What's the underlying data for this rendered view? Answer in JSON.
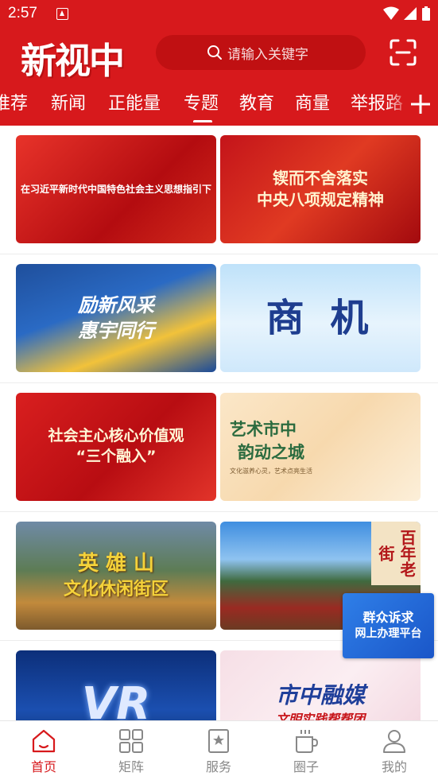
{
  "status": {
    "time": "2:57"
  },
  "header": {
    "logo": "新视中",
    "search_placeholder": "请输入关键字"
  },
  "tabs": [
    {
      "label": "推荐"
    },
    {
      "label": "新闻"
    },
    {
      "label": "正能量"
    },
    {
      "label": "专题",
      "active": true
    },
    {
      "label": "教育"
    },
    {
      "label": "商量"
    },
    {
      "label": "举报路"
    }
  ],
  "cards": [
    {
      "line1": "在习近平新时代中国特色社会主义思想指引下",
      "line2": ""
    },
    {
      "line1": "锲而不舍落实",
      "line2": "中央八项规定精神"
    },
    {
      "line1": "励新风采",
      "line2": "惠宇同行"
    },
    {
      "line1": "商 机",
      "line2": ""
    },
    {
      "line1": "社会主心核心价值观",
      "line2": "“三个融入”"
    },
    {
      "line1": "艺术市中",
      "line2": "韵动之城",
      "sub": "文化滋养心灵，艺术点亮生活"
    },
    {
      "line1": "英 雄 山",
      "line2": "文化休闲街区"
    },
    {
      "line1": "百年老街",
      "line2": ""
    },
    {
      "line1": "VR",
      "line2": ""
    },
    {
      "line1": "市中融媒",
      "line2": "文明实践帮帮团"
    }
  ],
  "float_banner": {
    "line1": "群众诉求",
    "line2": "网上办理平台"
  },
  "bottom_nav": [
    {
      "label": "首页",
      "icon": "home-icon",
      "active": true
    },
    {
      "label": "矩阵",
      "icon": "grid-icon"
    },
    {
      "label": "服务",
      "icon": "star-bookmark-icon"
    },
    {
      "label": "圈子",
      "icon": "cup-icon"
    },
    {
      "label": "我的",
      "icon": "user-icon"
    }
  ],
  "colors": {
    "brand_red": "#d7191c",
    "nav_active": "#d7191c",
    "nav_inactive": "#888888",
    "float_blue": "#2f7fe8"
  }
}
